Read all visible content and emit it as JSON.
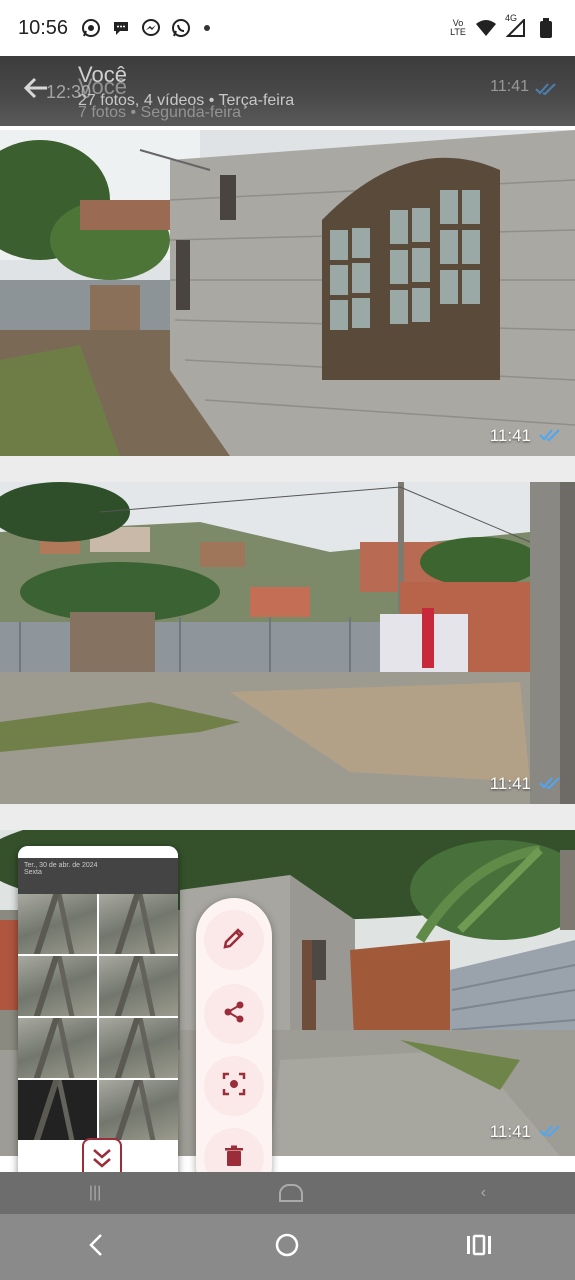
{
  "status_bar": {
    "time": "10:56",
    "left_icons": [
      "whatsapp-icon",
      "message-icon",
      "messenger-icon",
      "whatsapp-business-icon"
    ],
    "right_icons": [
      "volte-icon",
      "wifi-icon",
      "signal-4g-icon",
      "battery-icon"
    ],
    "volte_label": "Vo LTE",
    "network_label": "4G"
  },
  "header": {
    "back_icon": "arrow-left-icon",
    "overlay_time": "12:30",
    "title": "Você",
    "title_ghost": "Você",
    "subtitle": "27 fotos, 4 vídeos  •  Terça-feira",
    "subtitle_ghost": "7 fotos  •  Segunda-feira",
    "right_time": "11:41"
  },
  "photos": [
    {
      "time": "11:41",
      "status": "read-double-check-icon"
    },
    {
      "time": "11:41",
      "status": "read-double-check-icon"
    },
    {
      "time": "11:41",
      "status": "read-double-check-icon"
    }
  ],
  "mini_screenshot": {
    "header_text": "Ter., 30 de abr. de 2024",
    "header_sub": "Sexta"
  },
  "actions": [
    {
      "name": "edit",
      "icon": "pencil-icon"
    },
    {
      "name": "share",
      "icon": "share-icon"
    },
    {
      "name": "lens",
      "icon": "lens-scan-icon"
    },
    {
      "name": "delete",
      "icon": "trash-icon"
    }
  ],
  "nav": {
    "back_icon": "nav-back-icon",
    "home_icon": "nav-home-icon",
    "recents_icon": "nav-recents-icon"
  },
  "colors": {
    "accent": "#9b2c3a",
    "check_blue": "#4ea6f5",
    "panel_bg": "#fdf3f3"
  }
}
